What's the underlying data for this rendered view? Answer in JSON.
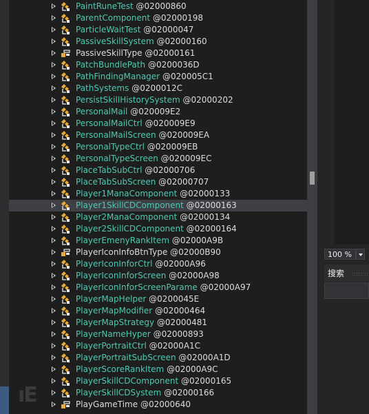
{
  "tree": {
    "items": [
      {
        "name": "PaintRuneTest",
        "token": "@02000860",
        "icon": "class-icon",
        "style": "class"
      },
      {
        "name": "ParentComponent",
        "token": "@02000198",
        "icon": "class-icon",
        "style": "class"
      },
      {
        "name": "ParticleWaitTest",
        "token": "@02000047",
        "icon": "class-icon",
        "style": "class"
      },
      {
        "name": "PassiveSkillSystem",
        "token": "@02000160",
        "icon": "class-icon",
        "style": "class"
      },
      {
        "name": "PassiveSkillType",
        "token": "@02000161",
        "icon": "enum-icon",
        "style": "plain"
      },
      {
        "name": "PatchBundlePath",
        "token": "@0200036D",
        "icon": "class-icon",
        "style": "class"
      },
      {
        "name": "PathFindingManager",
        "token": "@020005C1",
        "icon": "class-icon",
        "style": "class"
      },
      {
        "name": "PathSystems",
        "token": "@0200012C",
        "icon": "class-icon",
        "style": "class"
      },
      {
        "name": "PersistSkillHistorySystem",
        "token": "@02000202",
        "icon": "class-icon",
        "style": "class"
      },
      {
        "name": "PersonalMail",
        "token": "@020009E2",
        "icon": "class-icon",
        "style": "class"
      },
      {
        "name": "PersonalMailCtrl",
        "token": "@020009E9",
        "icon": "class-icon",
        "style": "class"
      },
      {
        "name": "PersonalMailScreen",
        "token": "@020009EA",
        "icon": "class-icon",
        "style": "class"
      },
      {
        "name": "PersonalTypeCtrl",
        "token": "@020009EB",
        "icon": "class-icon",
        "style": "class"
      },
      {
        "name": "PersonalTypeScreen",
        "token": "@020009EC",
        "icon": "class-icon",
        "style": "class"
      },
      {
        "name": "PlaceTabSubCtrl",
        "token": "@02000706",
        "icon": "class-icon",
        "style": "class"
      },
      {
        "name": "PlaceTabSubScreen",
        "token": "@02000707",
        "icon": "class-icon",
        "style": "class"
      },
      {
        "name": "Player1ManaComponent",
        "token": "@02000133",
        "icon": "class-icon",
        "style": "class"
      },
      {
        "name": "Player1SkillCDComponent",
        "token": "@02000163",
        "icon": "class-icon",
        "style": "class",
        "selected": true
      },
      {
        "name": "Player2ManaComponent",
        "token": "@02000134",
        "icon": "class-icon",
        "style": "class"
      },
      {
        "name": "Player2SkillCDComponent",
        "token": "@02000164",
        "icon": "class-icon",
        "style": "class"
      },
      {
        "name": "PlayerEmenyRankItem",
        "token": "@02000A9B",
        "icon": "class-icon",
        "style": "class"
      },
      {
        "name": "PlayerIconInfoBtnType",
        "token": "@02000B90",
        "icon": "enum-icon",
        "style": "plain"
      },
      {
        "name": "PlayerIconInforCtrl",
        "token": "@02000A96",
        "icon": "class-icon",
        "style": "class"
      },
      {
        "name": "PlayerIconInforScreen",
        "token": "@02000A98",
        "icon": "class-icon",
        "style": "class"
      },
      {
        "name": "PlayerIconInforScreenParame",
        "token": "@02000A97",
        "icon": "class-icon",
        "style": "class"
      },
      {
        "name": "PlayerMapHelper",
        "token": "@0200045E",
        "icon": "class-icon",
        "style": "class"
      },
      {
        "name": "PlayerMapModifier",
        "token": "@02000464",
        "icon": "class-icon",
        "style": "class"
      },
      {
        "name": "PlayerMapStrategy",
        "token": "@02000481",
        "icon": "class-icon",
        "style": "class"
      },
      {
        "name": "PlayerNameHyper",
        "token": "@02000893",
        "icon": "class-icon",
        "style": "class"
      },
      {
        "name": "PlayerPortraitCtrl",
        "token": "@02000A1C",
        "icon": "class-icon",
        "style": "class"
      },
      {
        "name": "PlayerPortraitSubScreen",
        "token": "@02000A1D",
        "icon": "class-icon-sealed",
        "style": "class"
      },
      {
        "name": "PlayerScoreRankItem",
        "token": "@02000A9C",
        "icon": "class-icon",
        "style": "class"
      },
      {
        "name": "PlayerSkillCDComponent",
        "token": "@02000165",
        "icon": "class-icon",
        "style": "class"
      },
      {
        "name": "PlayerSkillCDSystem",
        "token": "@02000166",
        "icon": "class-icon",
        "style": "class"
      },
      {
        "name": "PlayGameTime",
        "token": "@02000640",
        "icon": "enum-icon",
        "style": "plain"
      }
    ]
  },
  "zoom": {
    "value": "100 %"
  },
  "search": {
    "title": "搜索"
  },
  "colors": {
    "class_name": "#4ec9b0",
    "plain_name": "#dcdcdc",
    "icon_gold": "#e8ab3a",
    "icon_light": "#f0f0f0",
    "selection": "#3f3f46"
  }
}
